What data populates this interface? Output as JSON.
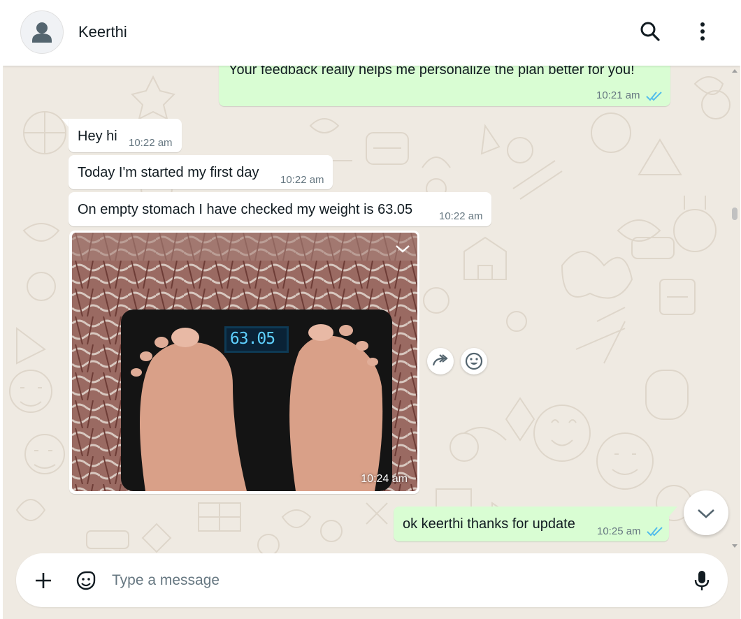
{
  "header": {
    "contact_name": "Keerthi"
  },
  "messages": {
    "m0": {
      "text": "Your feedback really helps me personalize the plan better for you!",
      "time": "10:21 am"
    },
    "m1": {
      "text": "Hey hi",
      "time": "10:22 am"
    },
    "m2": {
      "text": "Today I'm started my first day",
      "time": "10:22 am"
    },
    "m3": {
      "text": "On empty stomach I have checked my weight is 63.05",
      "time": "10:22 am"
    },
    "m4": {
      "scale_reading": "63.05",
      "time": "10:24 am"
    },
    "m5": {
      "text": "ok keerthi thanks for update",
      "time": "10:25 am"
    }
  },
  "composer": {
    "placeholder": "Type a message"
  },
  "colors": {
    "incoming": "#ffffff",
    "outgoing": "#d9fdd3",
    "read_ticks": "#53bdeb",
    "background": "#efeae2"
  },
  "icons": [
    "avatar-icon",
    "search-icon",
    "menu-icon",
    "double-check-icon",
    "chevron-down-icon",
    "forward-icon",
    "emoji-react-icon",
    "plus-icon",
    "sticker-icon",
    "mic-icon"
  ]
}
